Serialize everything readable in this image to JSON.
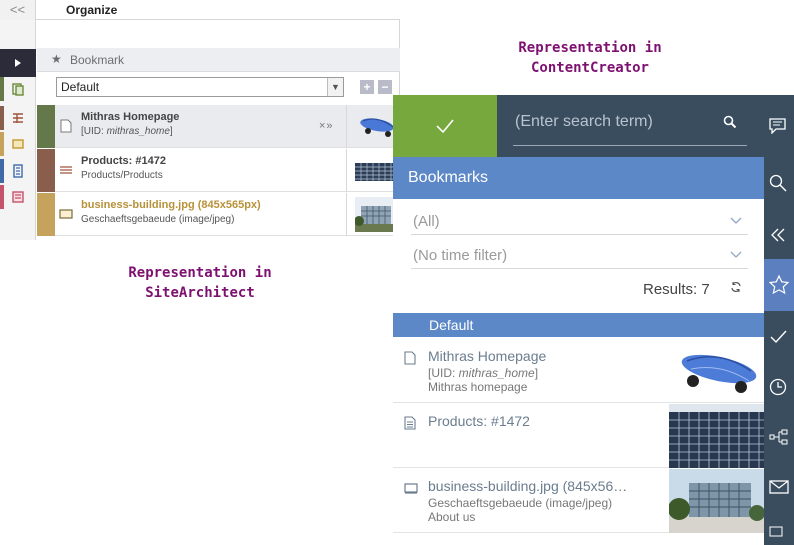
{
  "site_architect": {
    "collapse_glyph": "<<",
    "title": "Organize",
    "bookmark_label": "Bookmark",
    "selected_list": "Default",
    "add_label": "+",
    "remove_label": "−",
    "items": [
      {
        "title": "Mithras Homepage",
        "uid_prefix": "[UID: ",
        "uid": "mithras_home",
        "uid_suffix": "]",
        "controls": "×»",
        "title_color": "#4b4b4b"
      },
      {
        "title": "Products: #1472",
        "subtitle": "Products/Products",
        "title_color": "#4b4b4b"
      },
      {
        "title": "business-building.jpg (845x565px)",
        "subtitle": "Geschaeftsgebaeude (image/jpeg)",
        "title_color": "#b8913a"
      }
    ],
    "colors": {
      "page_stripe": "#657849",
      "section_stripe": "#8a5e4d",
      "media_stripe": "#c5a35c"
    }
  },
  "captions": {
    "site_architect": [
      "Representation in",
      "SiteArchitect"
    ],
    "content_creator": [
      "Representation in",
      "ContentCreator"
    ]
  },
  "content_creator": {
    "search_placeholder": "(Enter search term)",
    "panel_title": "Bookmarks",
    "filter_all": "(All)",
    "filter_time": "(No time filter)",
    "results": "Results: 7",
    "group": "Default",
    "items": [
      {
        "title": "Mithras Homepage",
        "line2_prefix": "[UID: ",
        "uid": "mithras_home",
        "line2_suffix": "]",
        "line3": "Mithras homepage"
      },
      {
        "title": "Products: #1472",
        "line2": "",
        "line3": ""
      },
      {
        "title": "business-building.jpg (845x56…",
        "line2": "Geschaeftsgebaeude (image/jpeg)",
        "line3": "About us"
      }
    ],
    "colors": {
      "accent_green": "#76a83e",
      "header_blue": "#5c88c8",
      "top_bar": "#3a4d5f"
    }
  }
}
